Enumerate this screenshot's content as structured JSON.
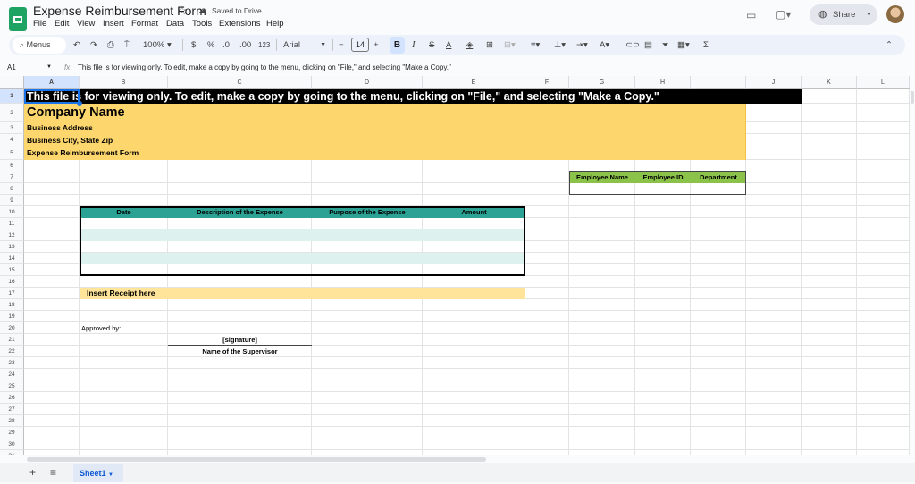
{
  "app": {
    "title": "Expense Reimbursement Form",
    "saved_status": "Saved to Drive",
    "share_label": "Share"
  },
  "menus": [
    "File",
    "Edit",
    "View",
    "Insert",
    "Format",
    "Data",
    "Tools",
    "Extensions",
    "Help"
  ],
  "toolbar": {
    "search_placeholder": "Menus",
    "zoom": "100%",
    "currency": "$",
    "percent": "%",
    "dec_decrease": ".0",
    "dec_increase": ".00",
    "number_format": "123",
    "font": "Arial",
    "font_size": "14",
    "minus": "−",
    "plus": "+",
    "bold": "B",
    "italic": "I",
    "strike": "S",
    "text_color": "A"
  },
  "formula_bar": {
    "cell_ref": "A1",
    "fx": "fx",
    "content": "This file is for viewing only. To edit, make a copy by going to the menu, clicking on \"File,\" and selecting \"Make a Copy.\""
  },
  "columns": [
    "A",
    "B",
    "C",
    "D",
    "E",
    "F",
    "G",
    "H",
    "I",
    "J",
    "K",
    "L"
  ],
  "rows": [
    "1",
    "2",
    "3",
    "4",
    "5",
    "6",
    "7",
    "8",
    "9",
    "10",
    "11",
    "12",
    "13",
    "14",
    "15",
    "16",
    "17",
    "18",
    "19",
    "20",
    "21",
    "22",
    "23",
    "24",
    "25",
    "26",
    "27",
    "28",
    "29",
    "30",
    "31"
  ],
  "sheet": {
    "notice": "This file is for viewing only. To edit, make a copy by going to the menu, clicking on \"File,\" and selecting \"Make a Copy.\"",
    "company_name": "Company Name",
    "business_address": "Business Address",
    "business_city": "Business City, State  Zip",
    "form_title": "Expense Reimbursement Form",
    "employee_headers": [
      "Employee Name",
      "Employee ID",
      "Department"
    ],
    "expense_headers": [
      "Date",
      "Description of the Expense",
      "Purpose of the Expense",
      "Amount"
    ],
    "insert_receipt": "Insert Receipt here",
    "approved_by": "Approved by:",
    "signature": "[signature]",
    "supervisor": "Name of the Supervisor"
  },
  "colors": {
    "teal": "#2ba293",
    "teal_light": "#ddf2ee",
    "yellow": "#fdd66e",
    "receipt": "#ffe49a",
    "green": "#8bc34a"
  },
  "tabs": [
    {
      "label": "Sheet1"
    }
  ]
}
